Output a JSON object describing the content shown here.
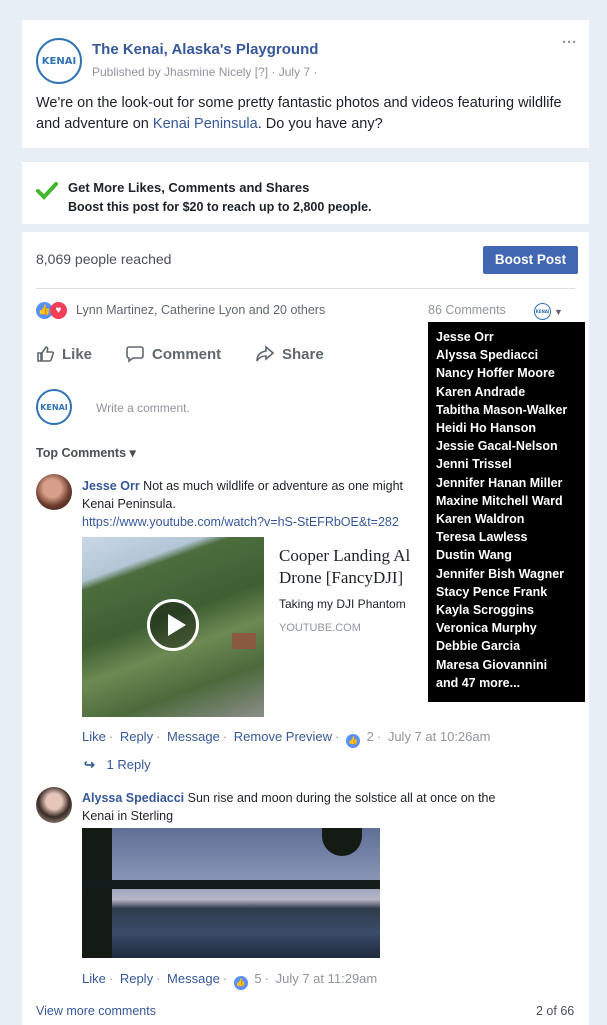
{
  "post": {
    "page_name": "The Kenai, Alaska's Playground",
    "published_by": "Published by Jhasmine Nicely [?] · July 7 ·",
    "more_label": "···",
    "text_part1": "We're on the look-out for some pretty fantastic photos and videos featuring wildlife and adventure on",
    "text_link": "Kenai Peninsula",
    "text_part2": ". Do you have any?"
  },
  "boost_banner": {
    "title": "Get More Likes, Comments and Shares",
    "subtitle": "Boost this post for $20 to reach up to 2,800 people."
  },
  "reach": {
    "text": "8,069 people reached",
    "button": "Boost Post"
  },
  "reactions": {
    "names": "Lynn Martinez, Catherine Lyon and 20 others",
    "comments_count": "86 Comments"
  },
  "actions": {
    "like": "Like",
    "comment": "Comment",
    "share": "Share"
  },
  "write_comment": {
    "placeholder": "Write a comment."
  },
  "top_comments_label": "Top Comments ▾",
  "tooltip_names": [
    "Jesse Orr",
    "Alyssa Spediacci",
    "Nancy Hoffer Moore",
    "Karen Andrade",
    "Tabitha Mason-Walker",
    "Heidi Ho Hanson",
    "Jessie Gacal-Nelson",
    "Jenni Trissel",
    "Jennifer Hanan Miller",
    "Maxine Mitchell Ward",
    "Karen Waldron",
    "Teresa Lawless",
    "Dustin Wang",
    "Jennifer Bish Wagner",
    "Stacy Pence Frank",
    "Kayla Scroggins",
    "Veronica Murphy",
    "Debbie Garcia",
    "Maresa Giovannini",
    "and 47 more..."
  ],
  "comment1": {
    "author": "Jesse Orr",
    "text": " Not as much wildlife or adventure as one might",
    "text2": "Kenai Peninsula.",
    "url": "https://www.youtube.com/watch?v=hS-StEFRbOE&t=282",
    "preview_title": "Cooper Landing Al",
    "preview_title2": "Drone [FancyDJI]",
    "preview_desc": "Taking my DJI Phantom",
    "preview_domain": "YOUTUBE.COM",
    "like": "Like",
    "reply": "Reply",
    "message": "Message",
    "remove_preview": "Remove Preview",
    "reaction_count": "2",
    "time": "July 7 at 10:26am",
    "replies": "1 Reply"
  },
  "comment2": {
    "author": "Alyssa Spediacci",
    "text": " Sun rise and moon during the solstice all at once on the",
    "text2": "Kenai in Sterling",
    "like": "Like",
    "reply": "Reply",
    "message": "Message",
    "reaction_count": "5",
    "time": "July 7 at 11:29am"
  },
  "footer": {
    "view_more": "View more comments",
    "pagination": "2 of 66"
  },
  "colors": {
    "brand_blue": "#4267b2",
    "link": "#365899",
    "check_green": "#42b72a"
  }
}
